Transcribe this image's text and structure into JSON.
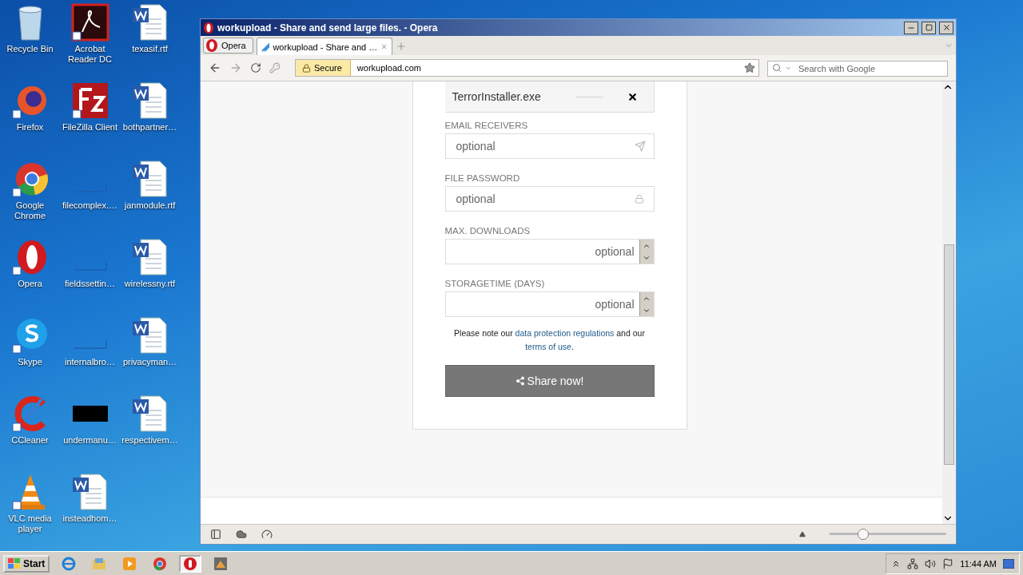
{
  "desktop": {
    "icons": [
      {
        "label": "Recycle Bin",
        "kind": "recycle"
      },
      {
        "label": "Firefox",
        "kind": "firefox"
      },
      {
        "label": "Google Chrome",
        "kind": "chrome"
      },
      {
        "label": "Opera",
        "kind": "opera"
      },
      {
        "label": "Skype",
        "kind": "skype"
      },
      {
        "label": "CCleaner",
        "kind": "ccleaner"
      },
      {
        "label": "VLC media player",
        "kind": "vlc"
      },
      {
        "label": "Acrobat Reader DC",
        "kind": "acrobat"
      },
      {
        "label": "FileZilla Client",
        "kind": "filezilla"
      },
      {
        "label": "filecomplex.…",
        "kind": "blank"
      },
      {
        "label": "fieldssettin…",
        "kind": "blank"
      },
      {
        "label": "internalbro…",
        "kind": "blank"
      },
      {
        "label": "undermanu…",
        "kind": "black"
      },
      {
        "label": "insteadhom…",
        "kind": "word"
      },
      {
        "label": "texasif.rtf",
        "kind": "word"
      },
      {
        "label": "bothpartner…",
        "kind": "word"
      },
      {
        "label": "janmodule.rtf",
        "kind": "word"
      },
      {
        "label": "wirelessny.rtf",
        "kind": "word"
      },
      {
        "label": "privacyman…",
        "kind": "word"
      },
      {
        "label": "respectivem…",
        "kind": "word"
      }
    ]
  },
  "window": {
    "title": "workupload - Share and send large files. - Opera"
  },
  "menu_button": "Opera",
  "tabs": [
    {
      "label": "workupload - Share and …",
      "selected": true
    }
  ],
  "address_bar": {
    "badge": "Secure",
    "url": "workupload.com"
  },
  "search": {
    "placeholder": "Search with Google"
  },
  "upload": {
    "file": "TerrorInstaller.exe",
    "level": 1
  },
  "fields": [
    {
      "label": "EMAIL RECEIVERS",
      "placeholder": "optional",
      "kind": "email"
    },
    {
      "label": "FILE PASSWORD",
      "placeholder": "optional",
      "kind": "password"
    },
    {
      "label": "MAX. DOWNLOADS",
      "placeholder": "optional",
      "kind": "number"
    },
    {
      "label": "STORAGETIME (DAYS)",
      "placeholder": "optional",
      "kind": "number"
    }
  ],
  "note": {
    "before": "Please note our",
    "link1": "data protection regulations",
    "middle": "and our",
    "link2": "terms of use",
    "after": "."
  },
  "share_button": "Share now!",
  "zoom": {
    "level": 0.28
  },
  "taskbar": {
    "start": "Start",
    "apps": [
      {
        "kind": "ie",
        "selected": false
      },
      {
        "kind": "explorer",
        "selected": false
      },
      {
        "kind": "media",
        "selected": false
      },
      {
        "kind": "chrome",
        "selected": false
      },
      {
        "kind": "opera",
        "selected": true
      },
      {
        "kind": "other",
        "selected": false
      }
    ],
    "clock": "11:44 AM"
  }
}
